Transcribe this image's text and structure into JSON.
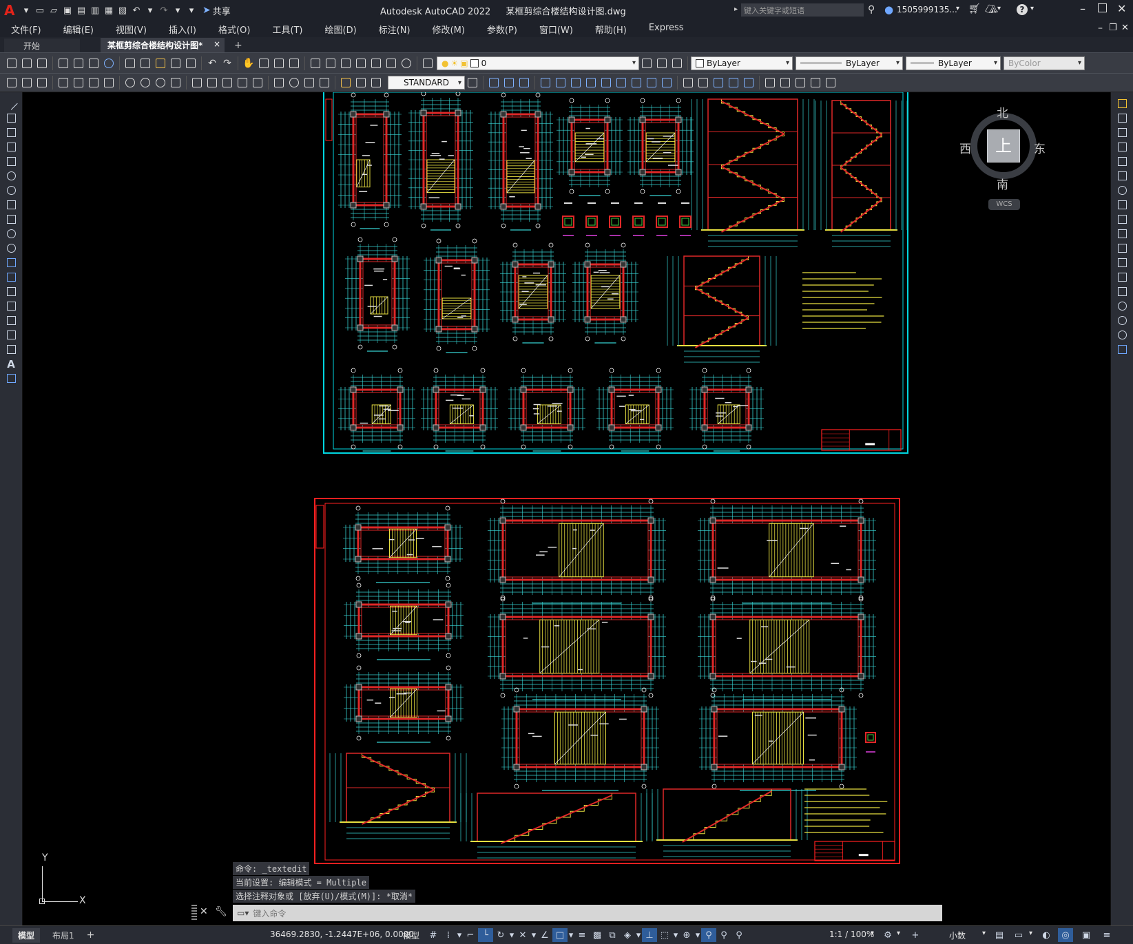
{
  "titlebar": {
    "app_title": "Autodesk AutoCAD 2022",
    "file_title": "某框剪综合楼结构设计图.dwg",
    "share_label": "共享",
    "search_placeholder": "键入关键字或短语",
    "user": "1505999135...",
    "help_label": "?"
  },
  "menu": [
    "文件(F)",
    "编辑(E)",
    "视图(V)",
    "插入(I)",
    "格式(O)",
    "工具(T)",
    "绘图(D)",
    "标注(N)",
    "修改(M)",
    "参数(P)",
    "窗口(W)",
    "帮助(H)",
    "Express"
  ],
  "tabs": {
    "start": "开始",
    "active": "某框剪综合楼结构设计图*",
    "close": "×",
    "add": "+"
  },
  "layer": {
    "current": "0"
  },
  "properties": {
    "color": "ByLayer",
    "linetype": "ByLayer",
    "lineweight": "ByLayer",
    "plotstyle": "ByColor"
  },
  "text_style": "STANDARD",
  "viewcube": {
    "north": "北",
    "south": "南",
    "east": "东",
    "west": "西",
    "top": "上",
    "wcs": "WCS"
  },
  "ucs": {
    "x": "X",
    "y": "Y"
  },
  "command": {
    "history": [
      "命令: _textedit",
      "当前设置: 编辑模式 = Multiple",
      "选择注释对象或 [放弃(U)/模式(M)]: *取消*"
    ],
    "placeholder": "键入命令"
  },
  "status": {
    "model_tab": "模型",
    "layout_tab": "布局1",
    "add_layout": "+",
    "coords": "36469.2830, -1.2447E+06, 0.0000",
    "space": "模型",
    "scale": "1:1 / 100%",
    "units": "小数"
  },
  "colors": {
    "frame_cyan": "#00d6e0",
    "frame_red": "#ff2020",
    "beam_red": "#e02828",
    "dim_cyan": "#37d4d4",
    "stair_yellow": "#e8e040",
    "green": "#3fd23f",
    "magenta": "#e040e0"
  }
}
